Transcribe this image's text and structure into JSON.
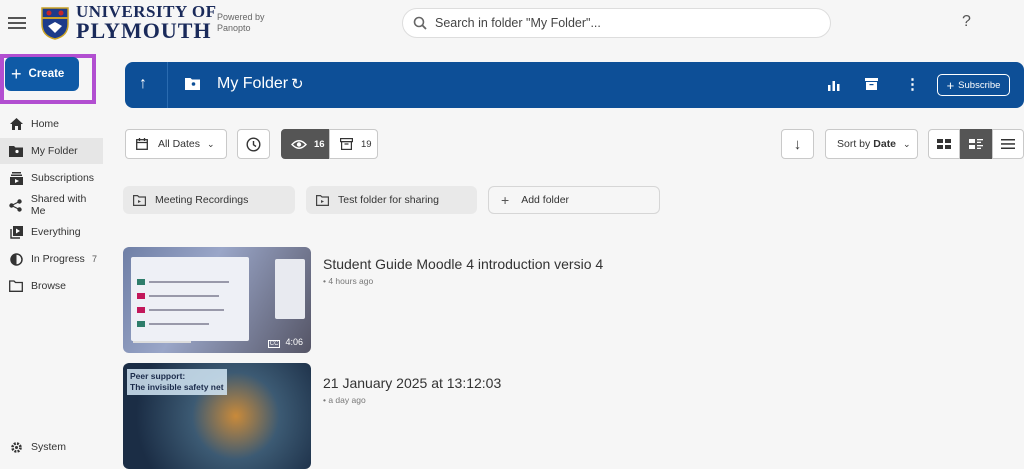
{
  "header": {
    "university_line1": "UNIVERSITY OF",
    "university_line2": "PLYMOUTH",
    "powered_line1": "Powered by",
    "powered_line2": "Panopto",
    "search_placeholder": "Search in folder \"My Folder\"...",
    "help_label": "?"
  },
  "sidebar": {
    "create_label": "Create",
    "items": [
      {
        "label": "Home",
        "icon": "home-icon"
      },
      {
        "label": "My Folder",
        "icon": "folder-user-icon",
        "active": true
      },
      {
        "label": "Subscriptions",
        "icon": "subscriptions-icon"
      },
      {
        "label": "Shared with Me",
        "icon": "share-icon"
      },
      {
        "label": "Everything",
        "icon": "play-library-icon"
      },
      {
        "label": "In Progress",
        "icon": "progress-icon",
        "count": "7"
      },
      {
        "label": "Browse",
        "icon": "folder-icon"
      }
    ],
    "system_label": "System"
  },
  "folderbar": {
    "title": "My Folder",
    "subscribe_label": "Subscribe"
  },
  "toolbar": {
    "dates_label": "All Dates",
    "viewed_count": "16",
    "archived_count": "19",
    "sort_prefix": "Sort by",
    "sort_value": "Date"
  },
  "folders": [
    {
      "label": "Meeting Recordings"
    },
    {
      "label": "Test folder for sharing"
    }
  ],
  "add_folder_label": "Add folder",
  "videos": [
    {
      "title": "Student Guide Moodle 4 introduction versio 4",
      "time": "4 hours ago",
      "duration": "4:06"
    },
    {
      "title": "21 January 2025 at 13:12:03",
      "time": "a day ago",
      "overlay_line1": "Peer support:",
      "overlay_line2": "The invisible safety net"
    }
  ],
  "colors": {
    "brand": "#0d4f97",
    "create": "#0f5aa6",
    "highlight": "#b24fd1"
  }
}
